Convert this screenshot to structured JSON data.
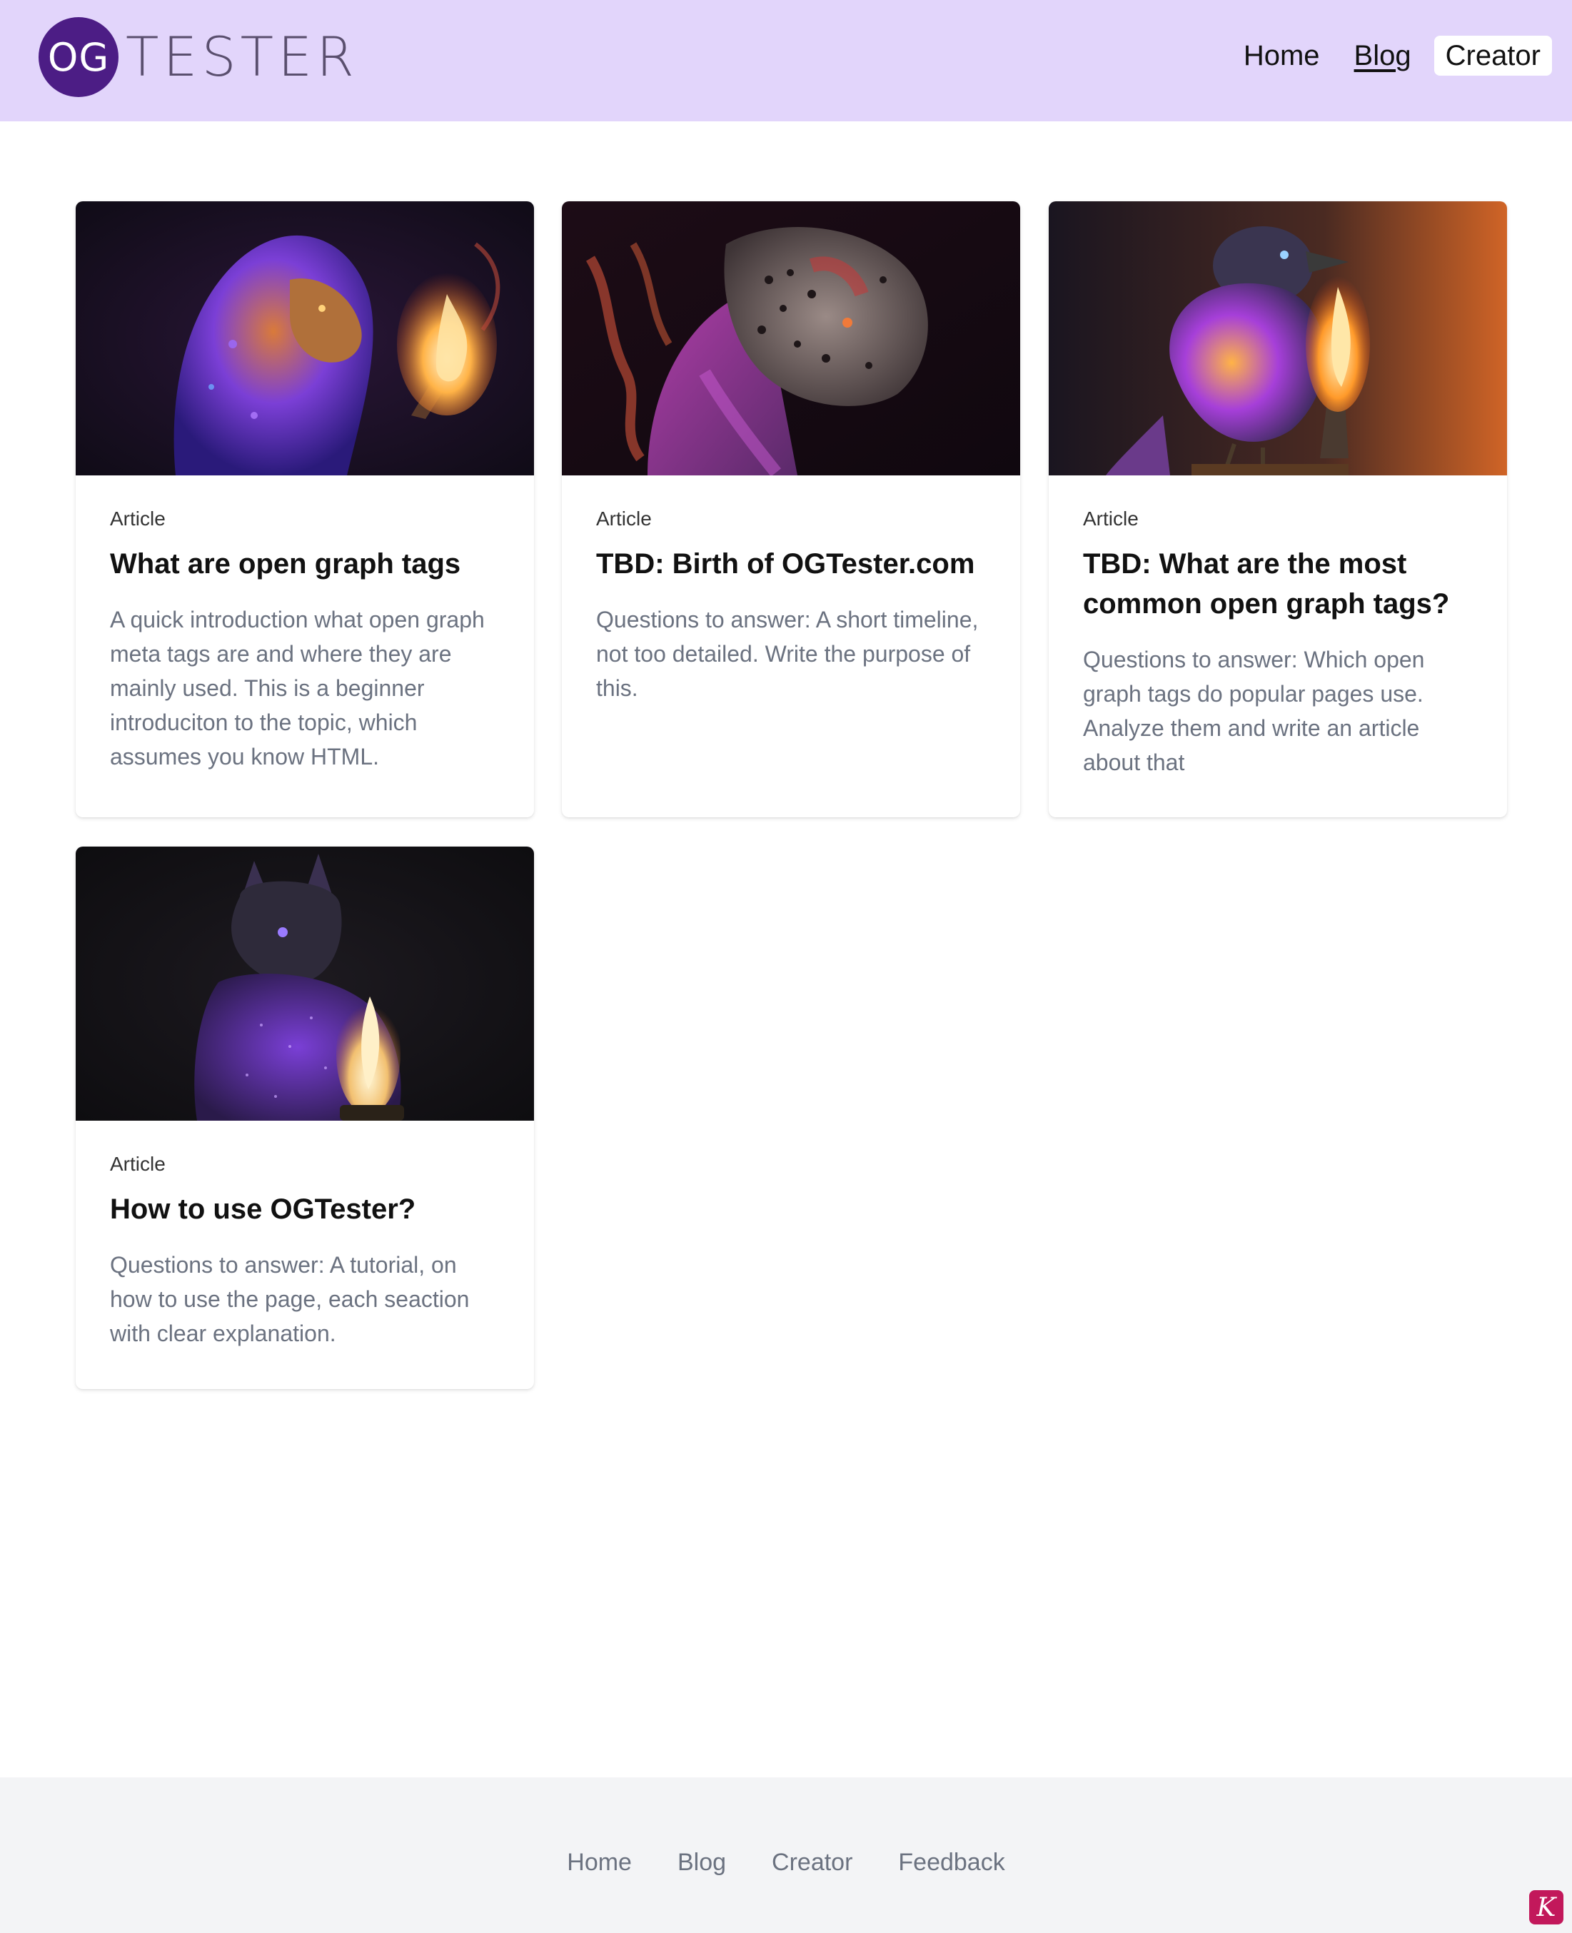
{
  "header": {
    "logo": {
      "circle_text": "OG",
      "text": "TESTER"
    },
    "nav": [
      {
        "label": "Home"
      },
      {
        "label": "Blog"
      },
      {
        "label": "Creator"
      }
    ]
  },
  "cards": [
    {
      "tag": "Article",
      "title": "What are open graph tags",
      "description": "A quick introduction what open graph meta tags are and where they are mainly used. This is a beginner introduciton to the topic, which assumes you know HTML.",
      "image": "lion-with-torch-image"
    },
    {
      "tag": "Article",
      "title": "TBD: Birth of OGTester.com",
      "description": "Questions to answer: A short timeline, not too detailed. Write the purpose of this.",
      "image": "leopard-image"
    },
    {
      "tag": "Article",
      "title": "TBD: What are the most common open graph tags?",
      "description": "Questions to answer: Which open graph tags do popular pages use. Analyze them and write an article about that",
      "image": "bird-with-flame-image"
    },
    {
      "tag": "Article",
      "title": "How to use OGTester?",
      "description": "Questions to answer: A tutorial, on how to use the page, each seaction with clear explanation.",
      "image": "cat-with-flame-image"
    }
  ],
  "footer": {
    "links": [
      {
        "label": "Home"
      },
      {
        "label": "Blog"
      },
      {
        "label": "Creator"
      },
      {
        "label": "Feedback"
      }
    ],
    "badge_letter": "K"
  },
  "colors": {
    "header_bg": "#e2d5fb",
    "logo_circle": "#4c1d85",
    "footer_bg": "#f3f4f6",
    "badge": "#c2185b"
  }
}
